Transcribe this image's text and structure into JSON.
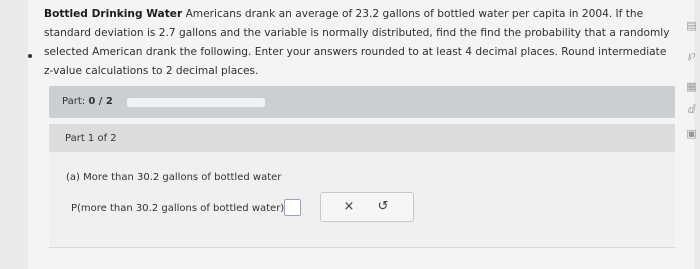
{
  "problem": {
    "topic": "Bottled Drinking Water",
    "text": "Americans drank an average of 23.2 gallons of bottled water per capita in 2004. If the standard deviation is 2.7 gallons and the variable is normally distributed, find the find the probability that a randomly selected American drank the following. Enter your answers rounded to at least 4 decimal places. Round intermediate z-value calculations to 2 decimal places."
  },
  "part": {
    "label": "Part:",
    "value": "0 / 2",
    "progress_fraction": 0
  },
  "subpart": {
    "label": "Part 1 of 2"
  },
  "question": {
    "prompt": "(a) More than 30.2 gallons of bottled water",
    "expression": "P(more than 30.2 gallons of bottled water) ="
  },
  "actions": {
    "clear_symbol": "×",
    "undo_symbol": "↺"
  },
  "side_rail": {
    "icons": [
      "calculator-icon",
      "stats-icon",
      "table-icon",
      "data-icon",
      "book-icon"
    ],
    "glyphs": [
      "▤",
      "℘",
      "▦",
      "ⅆ",
      "▣"
    ]
  }
}
